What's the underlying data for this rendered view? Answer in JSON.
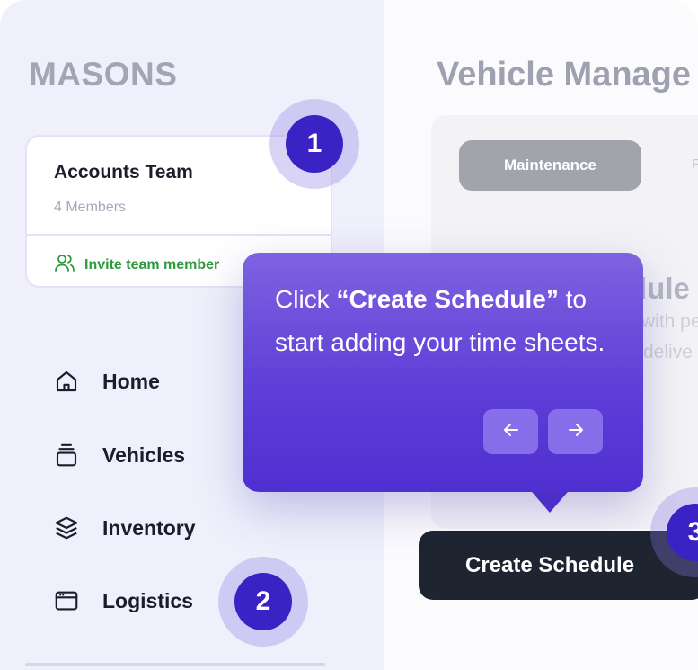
{
  "brand": {
    "name": "MASONS"
  },
  "team_card": {
    "name": "Accounts Team",
    "members": "4 Members",
    "invite_label": "Invite team member"
  },
  "nav": {
    "items": [
      {
        "label": "Home",
        "icon": "home-icon"
      },
      {
        "label": "Vehicles",
        "icon": "vehicles-icon"
      },
      {
        "label": "Inventory",
        "icon": "layers-icon"
      },
      {
        "label": "Logistics",
        "icon": "browser-window-icon"
      }
    ]
  },
  "main": {
    "title": "Vehicle Manage",
    "tabs": [
      {
        "label": "Maintenance"
      },
      {
        "label": "F"
      }
    ],
    "background_heading": "dule",
    "background_line1": "with pe",
    "background_line2": "delive",
    "create_button_label": "Create Schedule"
  },
  "steps": [
    "1",
    "2",
    "3"
  ],
  "tooltip": {
    "prefix": "Click ",
    "highlight": "“Create Schedule”",
    "suffix": " to start adding your time sheets.",
    "prev_icon": "arrow-left-icon",
    "next_icon": "arrow-right-icon"
  },
  "colors": {
    "accent": "#3a22c4",
    "tooltip_top": "#7e63e0",
    "tooltip_bottom": "#4f2fd0",
    "invite_green": "#2a9a3c",
    "dark_button": "#1e2430",
    "sidebar_bg": "#eff0fb"
  }
}
